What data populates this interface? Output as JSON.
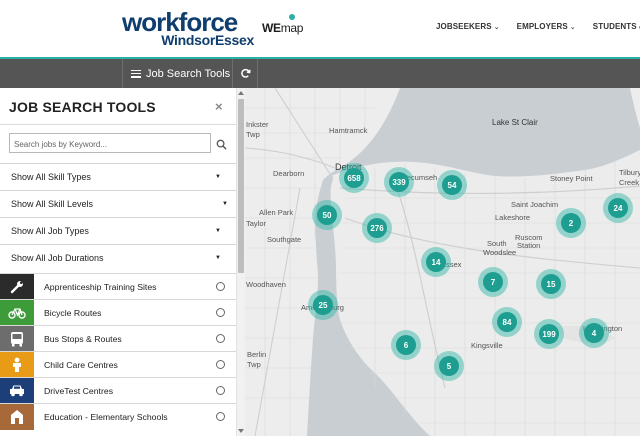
{
  "header": {
    "logo_main": "workforce",
    "logo_sub": "WindsorEssex",
    "wemap_bold": "WE",
    "wemap_light": "map",
    "nav": [
      {
        "label": "JOBSEEKERS"
      },
      {
        "label": "EMPLOYERS"
      },
      {
        "label": "STUDENTS & EDU"
      }
    ]
  },
  "toolbar": {
    "label": "Job Search Tools",
    "refresh_icon": "refresh-icon"
  },
  "panel": {
    "title": "JOB SEARCH TOOLS",
    "close_symbol": "×",
    "search_placeholder": "Search jobs by Keyword...",
    "filters": [
      {
        "label": "Show All Skill Types"
      },
      {
        "label": "Show All Skill Levels"
      },
      {
        "label": "Show All Job Types"
      },
      {
        "label": "Show All Job Durations"
      }
    ],
    "layers": [
      {
        "label": "Apprenticeship Training Sites",
        "icon": "wrench-icon",
        "color": "#2b2b2b"
      },
      {
        "label": "Bicycle Routes",
        "icon": "bicycle-icon",
        "color": "#3d9b3a"
      },
      {
        "label": "Bus Stops & Routes",
        "icon": "bus-icon",
        "color": "#6d6d6d"
      },
      {
        "label": "Child Care Centres",
        "icon": "child-icon",
        "color": "#e89b16"
      },
      {
        "label": "DriveTest Centres",
        "icon": "car-icon",
        "color": "#1c3f7a"
      },
      {
        "label": "Education - Elementary Schools",
        "icon": "school-icon",
        "color": "#a8693a"
      }
    ]
  },
  "map": {
    "places": [
      {
        "label": "Hamtramck"
      },
      {
        "label": "Inkster"
      },
      {
        "label": "Twp"
      },
      {
        "label": "Dearborn"
      },
      {
        "label": "Detroit",
        "big": true
      },
      {
        "label": "Allen Park"
      },
      {
        "label": "Taylor"
      },
      {
        "label": "Southgate"
      },
      {
        "label": "Woodhaven"
      },
      {
        "label": "Lake St Clair",
        "lake": true
      },
      {
        "label": "Tecumseh"
      },
      {
        "label": "Stoney Point"
      },
      {
        "label": "Saint Joachim"
      },
      {
        "label": "Lakeshore"
      },
      {
        "label": "Ruscom"
      },
      {
        "label": "Station"
      },
      {
        "label": "South"
      },
      {
        "label": "Woodslee"
      },
      {
        "label": "Essex"
      },
      {
        "label": "Kingsville"
      },
      {
        "label": "Amherstburg"
      },
      {
        "label": "Leamington"
      },
      {
        "label": "Tilbury"
      },
      {
        "label": "Creek"
      },
      {
        "label": "Berlin"
      },
      {
        "label": "Twp"
      }
    ],
    "clusters": [
      {
        "count": "658"
      },
      {
        "count": "339"
      },
      {
        "count": "54"
      },
      {
        "count": "50"
      },
      {
        "count": "276"
      },
      {
        "count": "2"
      },
      {
        "count": "24"
      },
      {
        "count": "14"
      },
      {
        "count": "7"
      },
      {
        "count": "15"
      },
      {
        "count": "25"
      },
      {
        "count": "84"
      },
      {
        "count": "199"
      },
      {
        "count": "4"
      },
      {
        "count": "6"
      },
      {
        "count": "5"
      }
    ]
  }
}
